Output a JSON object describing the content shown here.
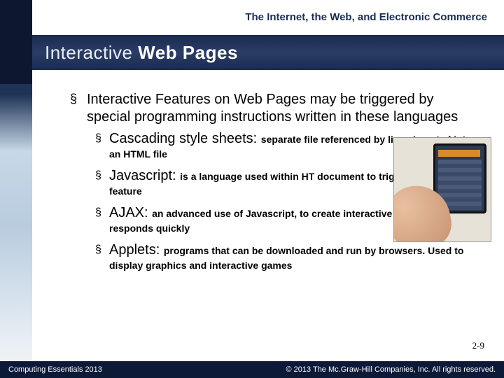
{
  "chapter_title": "The Internet, the Web, and Electronic Commerce",
  "slide_title_plain": "Interactive ",
  "slide_title_bold": "Web Pages",
  "main_bullet": "Interactive Features on Web Pages may be triggered by special programming instructions written in these languages",
  "items": [
    {
      "term": "Cascading style sheets: ",
      "desc": "separate file referenced by lines inserted into an HTML file"
    },
    {
      "term": "Javascript: ",
      "desc": "is a language used within HT document to trigger interactive feature"
    },
    {
      "term": "AJAX: ",
      "desc": "an advanced use of Javascript, to create interactive websites that responds quickly"
    },
    {
      "term": "Applets: ",
      "desc": "programs that can be downloaded and run by browsers. Used to display graphics and interactive games"
    }
  ],
  "page_num": "2-9",
  "footer_left": "Computing Essentials 2013",
  "footer_right": "© 2013 The Mc.Graw-Hill Companies, Inc. All rights reserved."
}
